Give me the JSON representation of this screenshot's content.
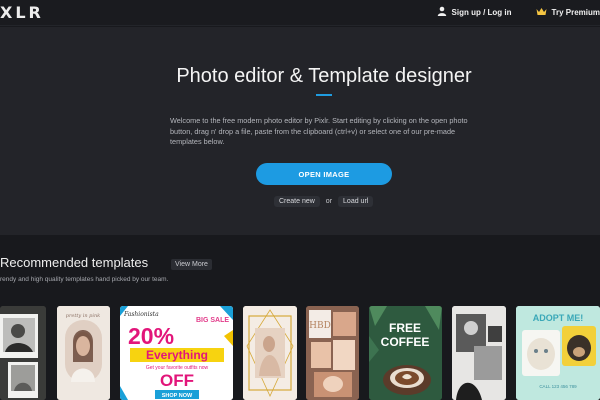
{
  "topbar": {
    "logo": "XLR",
    "signin_label": "Sign up / Log in",
    "premium_label": "Try Premium",
    "user_icon": "user-icon",
    "crown_icon": "crown-icon"
  },
  "hero": {
    "title": "Photo editor & Template designer",
    "description": "Welcome to the free modern photo editor by Pixlr. Start editing by clicking on the open photo button, drag n' drop a file, paste from the clipboard (ctrl+v) or select one of our pre-made templates below.",
    "open_button": "OPEN IMAGE",
    "create_new": "Create new",
    "or_text": "or",
    "load_url": "Load url"
  },
  "templates": {
    "title": "Recommended templates",
    "view_more": "View More",
    "subtitle": "rendy and high quality templates hand picked by our team.",
    "cards": [
      {
        "name": "template-card-photo-collage"
      },
      {
        "name": "template-card-beauty-portrait",
        "text": "pretty in pink"
      },
      {
        "name": "template-card-big-sale",
        "brand": "Fashionista",
        "tag": "BIG SALE",
        "percent": "20%",
        "banner": "Everything",
        "small": "Get your favorite outfits now",
        "off": "OFF",
        "cta": "SHOP NOW"
      },
      {
        "name": "template-card-gold-frame"
      },
      {
        "name": "template-card-brown-collage",
        "text": "HBD"
      },
      {
        "name": "template-card-free-coffee",
        "line1": "FREE",
        "line2": "COFFEE"
      },
      {
        "name": "template-card-bw-collage"
      },
      {
        "name": "template-card-adopt-me",
        "title": "ADOPT ME!",
        "footer": "CALL 123 456 789"
      }
    ]
  },
  "colors": {
    "accent": "#1d9be2",
    "background": "#18191d",
    "hero_bg": "#232429"
  }
}
